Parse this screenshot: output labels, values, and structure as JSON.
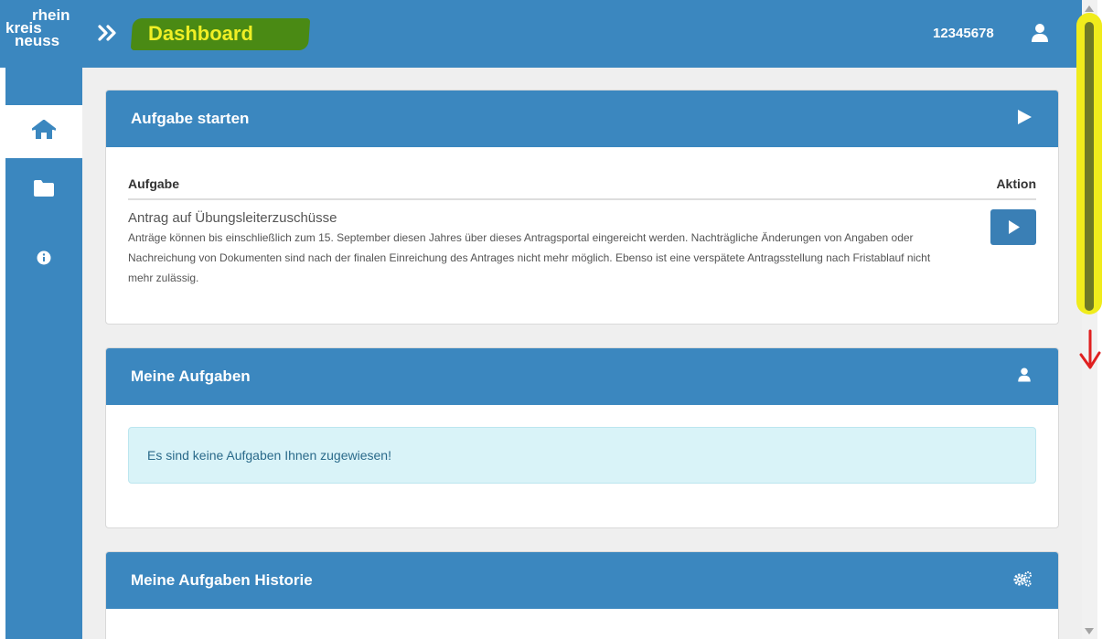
{
  "app": {
    "logo_lines": [
      "rhein",
      "kreis",
      "neuss"
    ],
    "title": "Dashboard",
    "user_id": "12345678"
  },
  "sidebar": {
    "items": [
      {
        "icon": "home-icon",
        "active": true
      },
      {
        "icon": "folder-icon",
        "active": false
      },
      {
        "icon": "info-icon",
        "active": false
      }
    ]
  },
  "start_task": {
    "title": "Aufgabe starten",
    "col_task": "Aufgabe",
    "col_action": "Aktion",
    "task_name": "Antrag auf Übungsleiterzuschüsse",
    "task_desc": "Anträge können bis einschließlich zum 15. September diesen Jahres über dieses Antragsportal eingereicht werden. Nachträgliche Änderungen von Angaben oder Nachreichung von Dokumenten sind nach der finalen Einreichung des Antrages nicht mehr möglich. Ebenso ist eine verspätete Antragsstellung nach Fristablauf nicht mehr zulässig."
  },
  "my_tasks": {
    "title": "Meine Aufgaben",
    "empty_message": "Es sind keine Aufgaben Ihnen zugewiesen!"
  },
  "history": {
    "title": "Meine Aufgaben Historie"
  },
  "colors": {
    "primary": "#3b87bf",
    "highlight_yellow": "#f0ec1c",
    "highlight_green": "#4a8a14",
    "annotation_red": "#e02020"
  }
}
